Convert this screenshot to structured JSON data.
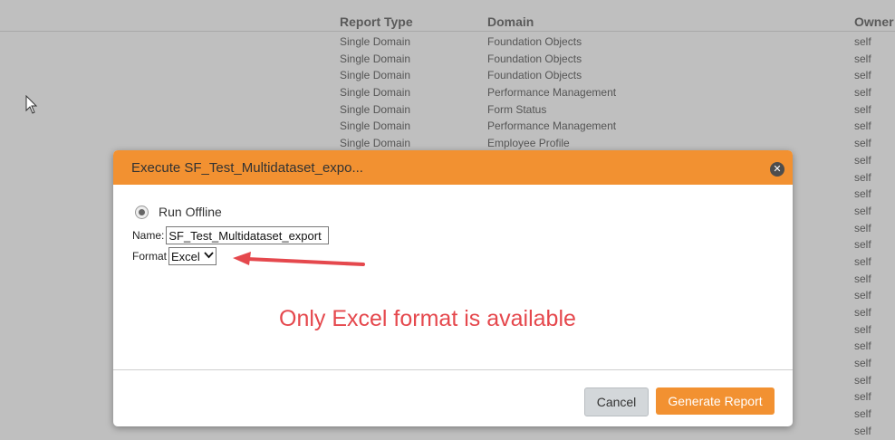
{
  "table": {
    "headers": {
      "report_type": "Report Type",
      "domain": "Domain",
      "owner": "Owner"
    },
    "rows": [
      {
        "type": "Single Domain",
        "domain": "Foundation Objects",
        "owner": "self"
      },
      {
        "type": "Single Domain",
        "domain": "Foundation Objects",
        "owner": "self"
      },
      {
        "type": "Single Domain",
        "domain": "Foundation Objects",
        "owner": "self"
      },
      {
        "type": "Single Domain",
        "domain": "Performance Management",
        "owner": "self"
      },
      {
        "type": "Single Domain",
        "domain": "Form Status",
        "owner": "self"
      },
      {
        "type": "Single Domain",
        "domain": "Performance Management",
        "owner": "self"
      },
      {
        "type": "Single Domain",
        "domain": "Employee Profile",
        "owner": "self"
      },
      {
        "type": "",
        "domain": "",
        "owner": "self"
      },
      {
        "type": "",
        "domain": "",
        "owner": "self"
      },
      {
        "type": "",
        "domain": "",
        "owner": "self"
      },
      {
        "type": "",
        "domain": "",
        "owner": "self"
      },
      {
        "type": "",
        "domain": "",
        "owner": "self"
      },
      {
        "type": "",
        "domain": "",
        "owner": "self"
      },
      {
        "type": "",
        "domain": "",
        "owner": "self"
      },
      {
        "type": "",
        "domain": "",
        "owner": "self"
      },
      {
        "type": "",
        "domain": "",
        "owner": "self"
      },
      {
        "type": "",
        "domain": "",
        "owner": "self"
      },
      {
        "type": "",
        "domain": "",
        "owner": "self"
      },
      {
        "type": "",
        "domain": "",
        "owner": "self"
      },
      {
        "type": "",
        "domain": "",
        "owner": "self"
      },
      {
        "type": "",
        "domain": "",
        "owner": "self"
      },
      {
        "type": "",
        "domain": "",
        "owner": "self"
      },
      {
        "type": "",
        "domain": "",
        "owner": "self"
      },
      {
        "type": "",
        "domain": "",
        "owner": "self"
      }
    ]
  },
  "modal": {
    "title": "Execute SF_Test_Multidataset_expo...",
    "close_icon": "close-icon",
    "run_offline_label": "Run Offline",
    "name_label": "Name:",
    "name_value": "SF_Test_Multidataset_export",
    "format_label": "Format",
    "format_value": "Excel",
    "annotation": "Only Excel format is available",
    "cancel_label": "Cancel",
    "generate_label": "Generate Report"
  },
  "colors": {
    "accent": "#f29131",
    "annotation": "#e5484d",
    "overlay": "#bfbfbf"
  }
}
